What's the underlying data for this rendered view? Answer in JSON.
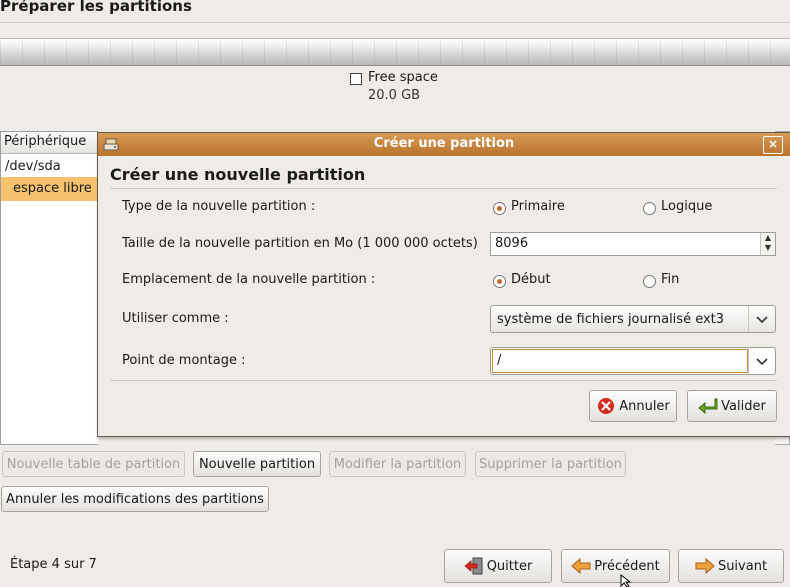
{
  "page": {
    "title": "Préparer les partitions"
  },
  "disk": {
    "legend_label": "Free space",
    "legend_size": "20.0 GB"
  },
  "table": {
    "header": "Périphérique",
    "rows": [
      "/dev/sda",
      "espace libre"
    ]
  },
  "dialog": {
    "window_title": "Créer une partition",
    "close_glyph": "×",
    "heading": "Créer une nouvelle partition",
    "type_label": "Type de la nouvelle partition :",
    "type_options": [
      "Primaire",
      "Logique"
    ],
    "type_selected": "Primaire",
    "size_label": "Taille de la nouvelle partition en Mo (1 000 000 octets)",
    "size_value": "8096",
    "location_label": "Emplacement de la nouvelle partition :",
    "location_options": [
      "Début",
      "Fin"
    ],
    "location_selected": "Début",
    "use_as_label": "Utiliser comme :",
    "use_as_value": "système de fichiers journalisé ext3",
    "mount_label": "Point de montage :",
    "mount_value": "/",
    "cancel_label": "Annuler",
    "ok_label": "Valider"
  },
  "partition_buttons": {
    "new_table": "Nouvelle table de partition",
    "new_partition": "Nouvelle partition",
    "modify": "Modifier la partition",
    "delete": "Supprimer la partition",
    "revert": "Annuler les modifications des partitions"
  },
  "footer": {
    "step": "Étape 4 sur 7",
    "quit": "Quitter",
    "back": "Précédent",
    "forward": "Suivant"
  },
  "colors": {
    "accent": "#c77e3a",
    "selection": "#f6c26d"
  },
  "icons": [
    "installer-disk-icon",
    "close-icon",
    "cancel-icon",
    "ok-icon",
    "quit-icon",
    "back-icon",
    "forward-icon",
    "chevron-down-icon"
  ]
}
